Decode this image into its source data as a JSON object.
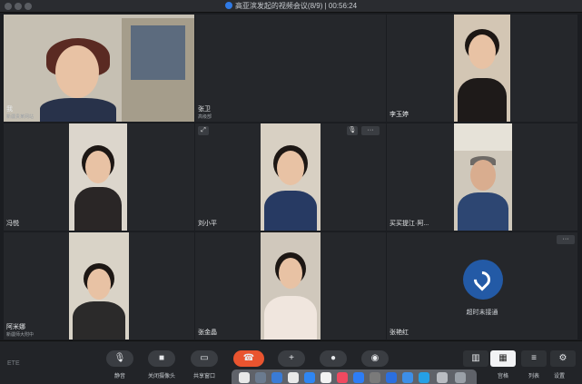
{
  "window": {
    "title": "高亚滨发起的视频会议(8/9) | 00:56:24"
  },
  "participants": [
    {
      "name": "我",
      "sub": "新疆贵某网站"
    },
    {
      "name": "张卫",
      "sub": "高级部"
    },
    {
      "name": "李玉婷",
      "sub": ""
    },
    {
      "name": "冯悦",
      "sub": ""
    },
    {
      "name": "刘小平",
      "sub": ""
    },
    {
      "name": "买买提江·阿...",
      "sub": ""
    },
    {
      "name": "阿米娜",
      "sub": "新疆师大附中"
    },
    {
      "name": "张金晶",
      "sub": ""
    },
    {
      "name": "张艳红",
      "sub": ""
    }
  ],
  "call_status": {
    "label": "超时未接通"
  },
  "tile_overlay": {
    "more": "···"
  },
  "toolbar": {
    "brand": "ETE",
    "buttons": [
      {
        "label": "静音"
      },
      {
        "label": "关闭摄像头"
      },
      {
        "label": "共享窗口"
      },
      {
        "label": ""
      },
      {
        "label": ""
      },
      {
        "label": ""
      },
      {
        "label": ""
      }
    ],
    "views": [
      {
        "label": ""
      },
      {
        "label": "宫格"
      },
      {
        "label": "列表"
      },
      {
        "label": "设置"
      }
    ]
  }
}
